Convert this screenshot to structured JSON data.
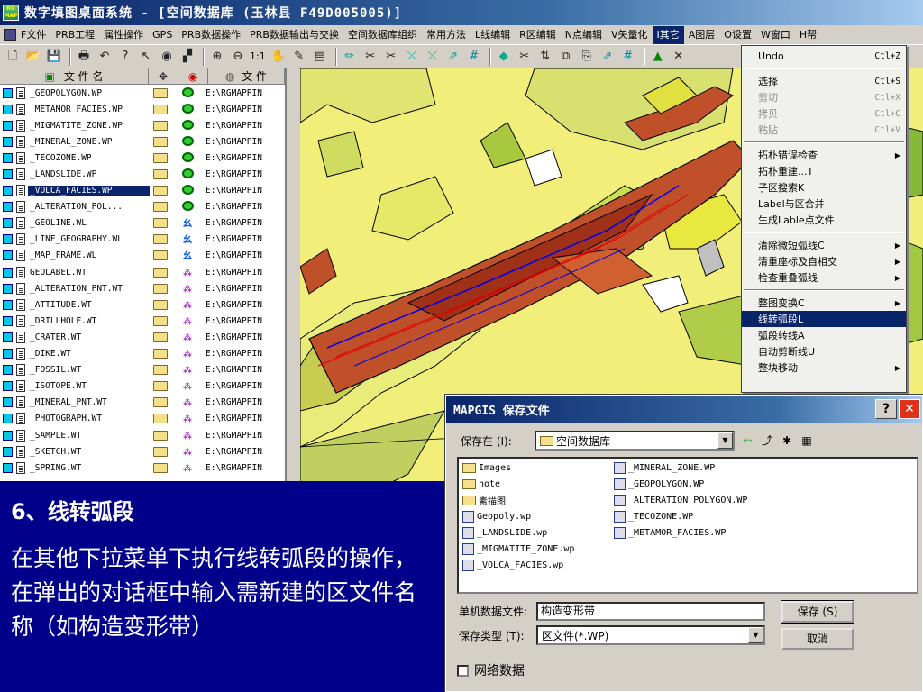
{
  "window": {
    "title": "数字填图桌面系统 - [空间数据库  (玉林县  F49D005005)]"
  },
  "menubar": [
    "F文件",
    "PRB工程",
    "属性操作",
    "GPS",
    "PRB数据操作",
    "PRB数据输出与交换",
    "空间数据库组织",
    "常用方法",
    "L线编辑",
    "R区编辑",
    "N点编辑",
    "V矢量化",
    "I其它",
    "A图层",
    "O设置",
    "W窗口",
    "H帮"
  ],
  "toolbar": {
    "zoom_label": "1:1"
  },
  "file_panel": {
    "headers": [
      "文 件 名",
      "文 件"
    ],
    "rows": [
      {
        "name": "_GEOPOLYGON.WP",
        "path": "E:\\RGMAPPIN",
        "type": "poly"
      },
      {
        "name": "_METAMOR_FACIES.WP",
        "path": "E:\\RGMAPPIN",
        "type": "poly"
      },
      {
        "name": "_MIGMATITE_ZONE.WP",
        "path": "E:\\RGMAPPIN",
        "type": "poly"
      },
      {
        "name": "_MINERAL_ZONE.WP",
        "path": "E:\\RGMAPPIN",
        "type": "poly"
      },
      {
        "name": "_TECOZONE.WP",
        "path": "E:\\RGMAPPIN",
        "type": "poly"
      },
      {
        "name": "_LANDSLIDE.WP",
        "path": "E:\\RGMAPPIN",
        "type": "poly"
      },
      {
        "name": "_VOLCA_FACIES.WP",
        "path": "E:\\RGMAPPIN",
        "type": "poly",
        "selected": true
      },
      {
        "name": "_ALTERATION_POL...",
        "path": "E:\\RGMAPPIN",
        "type": "poly"
      },
      {
        "name": "_GEOLINE.WL",
        "path": "E:\\RGMAPPIN",
        "type": "line"
      },
      {
        "name": "_LINE_GEOGRAPHY.WL",
        "path": "E:\\RGMAPPIN",
        "type": "line"
      },
      {
        "name": "_MAP_FRAME.WL",
        "path": "E:\\RGMAPPIN",
        "type": "line"
      },
      {
        "name": "GEOLABEL.WT",
        "path": "E:\\RGMAPPIN",
        "type": "point"
      },
      {
        "name": "_ALTERATION_PNT.WT",
        "path": "E:\\RGMAPPIN",
        "type": "point"
      },
      {
        "name": "_ATTITUDE.WT",
        "path": "E:\\RGMAPPIN",
        "type": "point"
      },
      {
        "name": "_DRILLHOLE.WT",
        "path": "E:\\RGMAPPIN",
        "type": "point"
      },
      {
        "name": "_CRATER.WT",
        "path": "E:\\RGMAPPIN",
        "type": "point"
      },
      {
        "name": "_DIKE.WT",
        "path": "E:\\RGMAPPIN",
        "type": "point"
      },
      {
        "name": "_FOSSIL.WT",
        "path": "E:\\RGMAPPIN",
        "type": "point"
      },
      {
        "name": "_ISOTOPE.WT",
        "path": "E:\\RGMAPPIN",
        "type": "point"
      },
      {
        "name": "_MINERAL_PNT.WT",
        "path": "E:\\RGMAPPIN",
        "type": "point"
      },
      {
        "name": "_PHOTOGRAPH.WT",
        "path": "E:\\RGMAPPIN",
        "type": "point"
      },
      {
        "name": "_SAMPLE.WT",
        "path": "E:\\RGMAPPIN",
        "type": "point"
      },
      {
        "name": "_SKETCH.WT",
        "path": "E:\\RGMAPPIN",
        "type": "point"
      },
      {
        "name": "_SPRING.WT",
        "path": "E:\\RGMAPPIN",
        "type": "point"
      }
    ]
  },
  "dropdown": [
    {
      "label": "Undo",
      "shortcut": "Ctl+Z"
    },
    {
      "sep": true
    },
    {
      "label": "选择",
      "shortcut": "Ctl+S"
    },
    {
      "label": "剪切",
      "shortcut": "Ctl+X",
      "disabled": true
    },
    {
      "label": "拷贝",
      "shortcut": "Ctl+C",
      "disabled": true
    },
    {
      "label": "粘贴",
      "shortcut": "Ctl+V",
      "disabled": true
    },
    {
      "sep": true
    },
    {
      "label": "拓朴错误检查",
      "submenu": true
    },
    {
      "label": "拓朴重建...T"
    },
    {
      "label": "子区搜索K"
    },
    {
      "label": "Label与区合并"
    },
    {
      "label": "生成Lable点文件"
    },
    {
      "sep": true
    },
    {
      "label": "清除微短弧线C",
      "submenu": true
    },
    {
      "label": "清重座标及自相交",
      "submenu": true
    },
    {
      "label": "检查重叠弧线",
      "submenu": true
    },
    {
      "sep": true
    },
    {
      "label": "整图变换C",
      "submenu": true
    },
    {
      "label": "线转弧段L",
      "highlighted": true
    },
    {
      "label": "弧段转线A"
    },
    {
      "label": "自动剪断线U"
    },
    {
      "label": "整块移动",
      "submenu": true
    }
  ],
  "instruction": {
    "title": "6、线转弧段",
    "body": "在其他下拉菜单下执行线转弧段的操作，在弹出的对话框中输入需新建的区文件名称（如构造变形带）"
  },
  "dialog": {
    "title": "MAPGIS 保存文件",
    "save_in_label": "保存在 (I):",
    "save_in_value": "空间数据库",
    "files_col1": [
      {
        "name": "Images",
        "kind": "folder"
      },
      {
        "name": "note",
        "kind": "folder"
      },
      {
        "name": "素描图",
        "kind": "folder"
      },
      {
        "name": "Geopoly.wp",
        "kind": "file"
      },
      {
        "name": "_LANDSLIDE.wp",
        "kind": "file"
      },
      {
        "name": "_MIGMATITE_ZONE.wp",
        "kind": "file"
      },
      {
        "name": "_VOLCA_FACIES.wp",
        "kind": "file"
      }
    ],
    "files_col2": [
      {
        "name": "_MINERAL_ZONE.WP",
        "kind": "file"
      },
      {
        "name": "_GEOPOLYGON.WP",
        "kind": "file"
      },
      {
        "name": "_ALTERATION_POLYGON.WP",
        "kind": "file"
      },
      {
        "name": "_TECOZONE.WP",
        "kind": "file"
      },
      {
        "name": "_METAMOR_FACIES.WP",
        "kind": "file"
      }
    ],
    "filename_label": "单机数据文件:",
    "filename_value": "构造变形带",
    "filetype_label": "保存类型 (T):",
    "filetype_value": "区文件(*.WP)",
    "save_button": "保存 (S)",
    "cancel_button": "取消",
    "network_label": "网络数据"
  }
}
